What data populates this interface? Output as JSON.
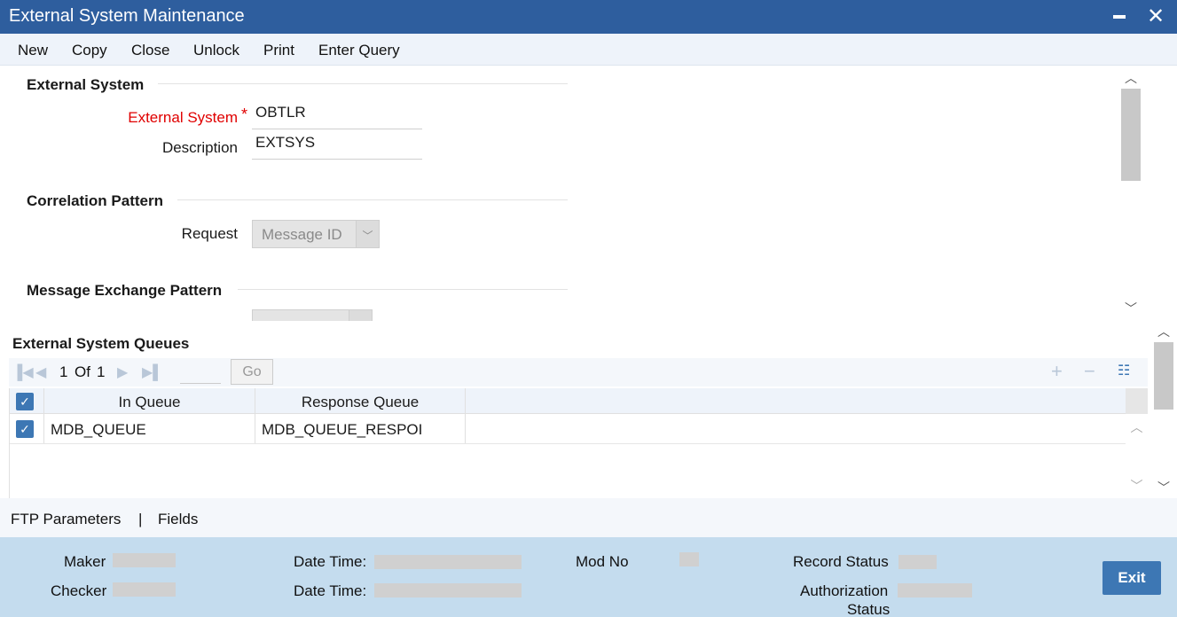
{
  "window": {
    "title": "External System Maintenance"
  },
  "toolbar": {
    "new": "New",
    "copy": "Copy",
    "close": "Close",
    "unlock": "Unlock",
    "print": "Print",
    "enter_query": "Enter Query"
  },
  "external_system_section": {
    "title": "External System",
    "external_system_label": "External System",
    "required_mark": "*",
    "external_system_value": "OBTLR",
    "description_label": "Description",
    "description_value": "EXTSYS"
  },
  "correlation_section": {
    "title": "Correlation Pattern",
    "request_label": "Request",
    "request_value": "Message ID"
  },
  "message_exchange_section": {
    "title": "Message Exchange Pattern"
  },
  "queues": {
    "title": "External System Queues",
    "page_current": "1",
    "page_of": "Of",
    "page_total": "1",
    "go_label": "Go",
    "columns": {
      "in_queue": "In Queue",
      "response_queue": "Response Queue"
    },
    "rows": [
      {
        "in_queue": "MDB_QUEUE",
        "response_queue": "MDB_QUEUE_RESPOI"
      }
    ]
  },
  "tabs": {
    "ftp": "FTP Parameters",
    "separator": "|",
    "fields": "Fields"
  },
  "footer": {
    "maker_label": "Maker",
    "checker_label": "Checker",
    "date_time_label": "Date Time:",
    "mod_no_label": "Mod No",
    "record_status_label": "Record Status",
    "authorization_label": "Authorization",
    "status_label": "Status",
    "exit_label": "Exit"
  },
  "colors": {
    "title_bar": "#2e5e9e",
    "accent": "#3d77b4",
    "footer_bg": "#c4dcee",
    "required": "#e00000"
  },
  "icons": [
    "close-icon",
    "minimize-icon",
    "chevron-down-icon",
    "first-page-icon",
    "previous-page-icon",
    "next-page-icon",
    "last-page-icon",
    "add-row-icon",
    "delete-row-icon",
    "single-view-icon",
    "checkbox-checked-icon"
  ]
}
